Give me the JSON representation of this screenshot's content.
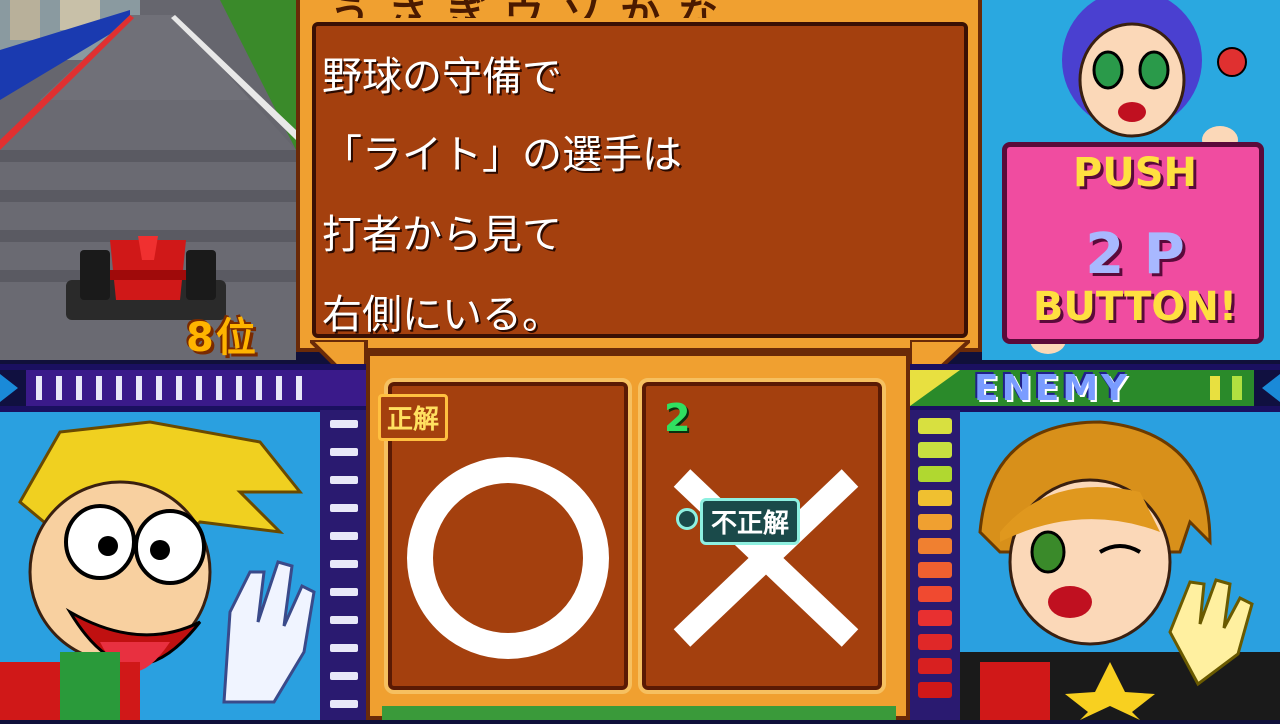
{
  "race": {
    "place_label": "8位"
  },
  "question": {
    "header": "うさぎウソかな",
    "lines": [
      "野球の守備で",
      "「ライト」の選手は",
      "打者から見て",
      "右側にいる。"
    ]
  },
  "answers": {
    "circle_symbol": "○",
    "cross_symbol": "×",
    "correct_tag": "正解",
    "wrong_tag": "不正解",
    "cross_count": "2"
  },
  "player2": {
    "enemy_label": "ENEMY",
    "push_line1": "PUSH",
    "push_line2": "2 P",
    "push_line3": "BUTTON!"
  },
  "colors": {
    "panel_orange": "#f0a030",
    "panel_brown": "#a4400e",
    "sign_pink": "#f04ca0",
    "sign_yellow": "#ffe040",
    "count_green": "#30e060"
  }
}
